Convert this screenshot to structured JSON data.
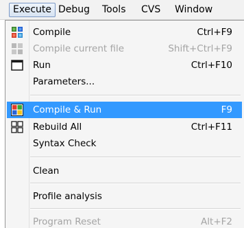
{
  "menubar": {
    "items": [
      {
        "label": "Execute"
      },
      {
        "label": "Debug"
      },
      {
        "label": "Tools"
      },
      {
        "label": "CVS"
      },
      {
        "label": "Window"
      }
    ]
  },
  "menu": {
    "items": [
      {
        "label": "Compile",
        "shortcut": "Ctrl+F9",
        "icon": "compile-icon",
        "disabled": false
      },
      {
        "label": "Compile current file",
        "shortcut": "Shift+Ctrl+F9",
        "icon": "compile-current-file-icon",
        "disabled": true
      },
      {
        "label": "Run",
        "shortcut": "Ctrl+F10",
        "icon": "run-icon",
        "disabled": false
      },
      {
        "label": "Parameters...",
        "shortcut": "",
        "icon": "",
        "disabled": false
      },
      {
        "label": "Compile & Run",
        "shortcut": "F9",
        "icon": "compile-and-run-icon",
        "disabled": false,
        "highlighted": true
      },
      {
        "label": "Rebuild All",
        "shortcut": "Ctrl+F11",
        "icon": "rebuild-all-icon",
        "disabled": false
      },
      {
        "label": "Syntax Check",
        "shortcut": "",
        "icon": "",
        "disabled": false
      },
      {
        "label": "Clean",
        "shortcut": "",
        "icon": "",
        "disabled": false
      },
      {
        "label": "Profile analysis",
        "shortcut": "",
        "icon": "",
        "disabled": false
      },
      {
        "label": "Program Reset",
        "shortcut": "Alt+F2",
        "icon": "",
        "disabled": true
      }
    ]
  },
  "colors": {
    "highlight": "#3399ff",
    "disabled_text": "#a4a4a4"
  }
}
